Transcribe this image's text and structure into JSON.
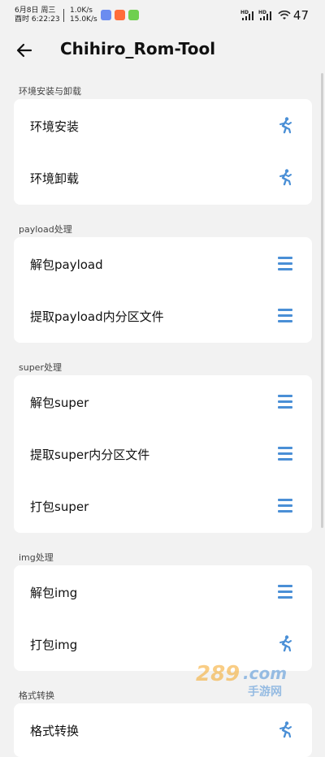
{
  "status_bar": {
    "date": "6月8日 周三",
    "time": "酉时 6:22:23",
    "up_speed": "1.0K/s",
    "down_speed": "15.0K/s",
    "battery": "47"
  },
  "app_bar": {
    "back_icon": "arrow-left-icon",
    "title": "Chihiro_Rom-Tool"
  },
  "sections": [
    {
      "title": "环境安装与卸载",
      "items": [
        {
          "label": "环境安装",
          "icon": "running-person-icon"
        },
        {
          "label": "环境卸载",
          "icon": "running-person-icon"
        }
      ]
    },
    {
      "title": "payload处理",
      "items": [
        {
          "label": "解包payload",
          "icon": "menu-icon"
        },
        {
          "label": "提取payload内分区文件",
          "icon": "menu-icon"
        }
      ]
    },
    {
      "title": "super处理",
      "items": [
        {
          "label": "解包super",
          "icon": "menu-icon"
        },
        {
          "label": "提取super内分区文件",
          "icon": "menu-icon"
        },
        {
          "label": "打包super",
          "icon": "menu-icon"
        }
      ]
    },
    {
      "title": "img处理",
      "items": [
        {
          "label": "解包img",
          "icon": "menu-icon"
        },
        {
          "label": "打包img",
          "icon": "running-person-icon"
        }
      ]
    },
    {
      "title": "格式转换",
      "items": [
        {
          "label": "格式转换",
          "icon": "running-person-icon"
        }
      ]
    }
  ],
  "watermark": {
    "site": "289.com",
    "tagline": "手游网"
  },
  "colors": {
    "accent": "#4a8fd6",
    "background": "#f2f2f2",
    "card": "#ffffff"
  }
}
